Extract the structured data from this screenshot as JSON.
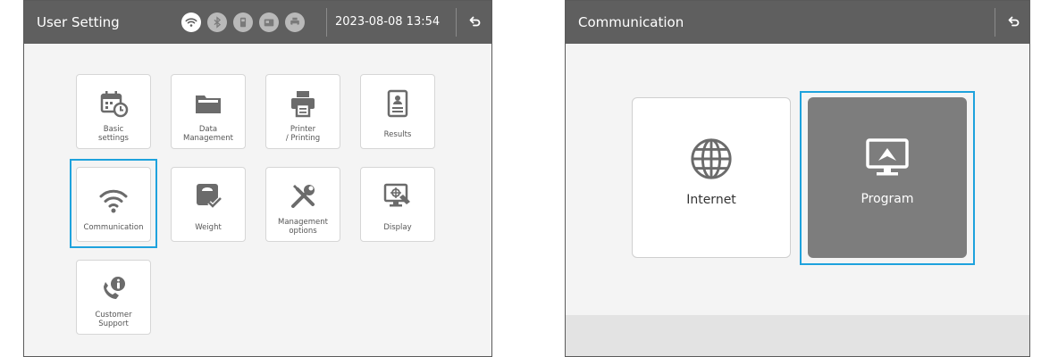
{
  "left_screen": {
    "title": "User Setting",
    "datetime": "2023-08-08 13:54",
    "status_icons": [
      {
        "name": "wifi-status-icon",
        "active": true
      },
      {
        "name": "bluetooth-status-icon",
        "active": false
      },
      {
        "name": "device-status-icon",
        "active": false
      },
      {
        "name": "card-status-icon",
        "active": false
      },
      {
        "name": "printer-status-icon",
        "active": false
      }
    ],
    "tiles": [
      {
        "label": "Basic\nsettings",
        "icon": "calendar-clock-icon"
      },
      {
        "label": "Data\nManagement",
        "icon": "folder-icon"
      },
      {
        "label": "Printer\n/ Printing",
        "icon": "printer-icon"
      },
      {
        "label": "Results",
        "icon": "report-icon"
      },
      {
        "label": "Communication",
        "icon": "wifi-icon",
        "selected": true
      },
      {
        "label": "Weight",
        "icon": "scale-icon"
      },
      {
        "label": "Management\noptions",
        "icon": "tools-icon"
      },
      {
        "label": "Display",
        "icon": "monitor-icon"
      },
      {
        "label": "Customer\nSupport",
        "icon": "phone-info-icon"
      }
    ]
  },
  "right_screen": {
    "title": "Communication",
    "options": [
      {
        "label": "Internet",
        "icon": "globe-icon"
      },
      {
        "label": "Program",
        "icon": "monitor-program-icon",
        "selected": true
      }
    ]
  },
  "colors": {
    "header": "#5f5f5f",
    "selection": "#1ea2dd",
    "icon": "#6b6b6b",
    "selected_tile": "#7d7d7d"
  }
}
